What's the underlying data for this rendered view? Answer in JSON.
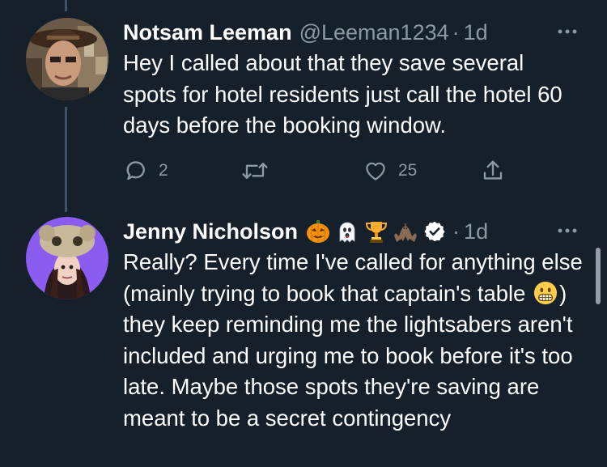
{
  "tweets": [
    {
      "name": "Notsam Leeman",
      "handle": "@Leeman1234",
      "separator": "·",
      "time": "1d",
      "text": "Hey I called about that they save several spots for hotel residents just call the hotel 60 days before the booking window.",
      "actions": {
        "reply_count": "2",
        "retweet_count": "",
        "like_count": "25"
      },
      "icons": [
        "reply-icon",
        "retweet-icon",
        "like-icon",
        "share-icon",
        "more-icon"
      ]
    },
    {
      "name": "Jenny Nicholson",
      "name_emojis": [
        "jack-o-lantern-emoji",
        "ghost-emoji",
        "trophy-emoji",
        "bat-emoji"
      ],
      "verified": true,
      "separator": "·",
      "time": "1d",
      "text_part1": "Really? Every time I've called for anything else (mainly trying to book that captain's table ",
      "inline_emoji": "grimacing-face-emoji",
      "text_part2": ") they keep reminding me the lightsabers aren't included and urging me to book before it's too late. Maybe those spots they're saving are meant to be a secret contingency"
    }
  ],
  "colors": {
    "background": "#15202b",
    "secondary_text": "#8b98a5",
    "thread_line": "#3d5466"
  }
}
